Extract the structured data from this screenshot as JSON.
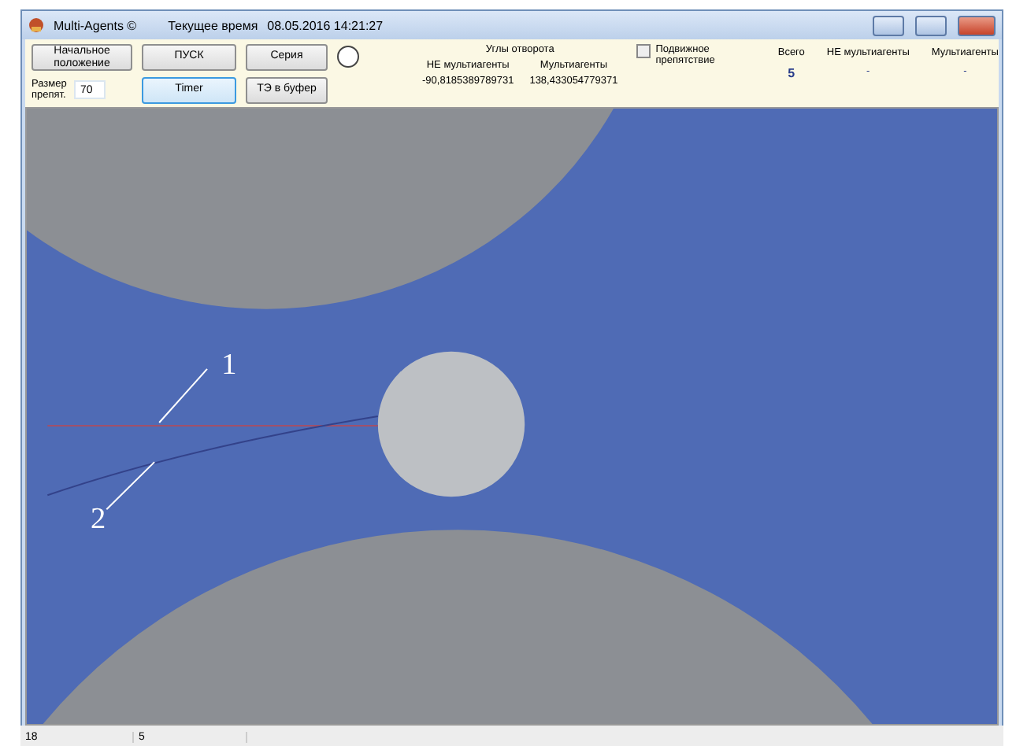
{
  "window": {
    "title": "Multi-Agents ©",
    "clock_label": "Текущее время",
    "clock_value": "08.05.2016 14:21:27"
  },
  "toolbar": {
    "buttons": [
      {
        "label": "Начальное положение",
        "focused": false
      },
      {
        "label": "ПУСК",
        "focused": false
      },
      {
        "label": "Серия",
        "focused": false
      },
      {
        "label": "Timer",
        "focused": true
      },
      {
        "label": "ТЭ в буфер",
        "focused": false
      }
    ],
    "size_label": "Размер препят.",
    "size_value": "70",
    "angles": {
      "heading": "Углы отворота",
      "columns": [
        "НЕ мультиагенты",
        "Мультиагенты"
      ],
      "values": [
        "-90,8185389789731",
        "138,433054779371"
      ]
    },
    "moving_obstacle": {
      "label": "Подвижное препятствие",
      "checked": false
    },
    "counts": {
      "columns": [
        "Всего",
        "НЕ мультиагенты",
        "Мультиагенты"
      ],
      "values": [
        "5",
        "-",
        "-"
      ]
    }
  },
  "canvas": {
    "annotations": [
      {
        "label": "1"
      },
      {
        "label": "2"
      }
    ]
  },
  "status_bar": [
    "18",
    "5"
  ]
}
